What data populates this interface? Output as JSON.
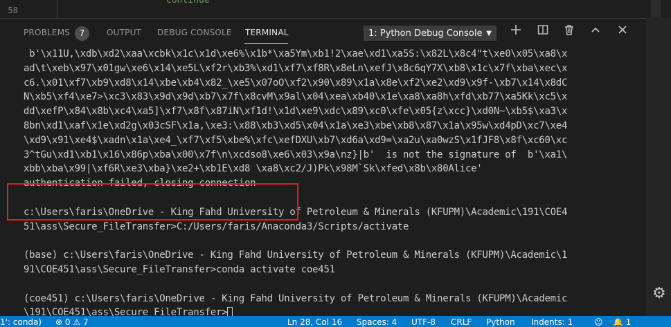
{
  "editor": {
    "line_number": "58",
    "code_fragment": "continue"
  },
  "panel": {
    "tabs": {
      "problems": "PROBLEMS",
      "problems_count": "7",
      "output": "OUTPUT",
      "debug_console": "DEBUG CONSOLE",
      "terminal": "TERMINAL"
    },
    "terminal_selector": "1: Python Debug Console",
    "icons": [
      "plus-icon",
      "split-icon",
      "trash-icon",
      "chevron-up-icon",
      "close-icon"
    ]
  },
  "terminal": {
    "lines": [
      " b'\\x11U,\\xdb\\xd2\\xaa\\xcbk\\x1c\\x1d\\xe6%\\x1b*\\xa5Ym\\xb1!2\\xae\\xd1\\xa5S:\\x82L\\x8c4\"t\\xe0\\x05\\xa8\\x",
      "ad\\t\\xeb\\x97\\x01gw\\xe6\\x14\\xe5L\\xf2r\\xb3%\\xd1\\xf7\\xf8R\\x8eLn\\xefJ\\x8c6qY7X\\xb8\\x1c\\x7f\\xba\\xec\\x",
      "c6.\\x01\\xf7\\xb9\\xd8\\x14\\xbe\\xb4\\x82_\\xe5\\x07oO\\xf2\\x90\\x89\\x1a\\x8e\\xf2\\xe2\\xd9\\x9f-\\xb7\\x14\\x8dC",
      "N\\xb5\\xf4\\xe7>\\xc3\\x83\\x9d\\x9d\\xb7\\x7f\\x8cvM\\x9al\\x04\\xea\\xb40\\x1e\\xa8\\xa8h\\xfd\\xb77\\xa5Kk\\xc5\\x",
      "dd\\xefP\\x84\\x8b\\xc4\\xa5]\\xf7\\x8f\\x87iN\\xf1d!\\x1d\\xe9\\xdc\\x89\\xc0\\xfe\\x05{z\\xcc}\\xd0N~\\xb5$\\xa3\\x",
      "8bn\\xd1\\xaf\\x1e\\xd2g\\x03cSF\\x1a,\\xe3:\\x88\\xb3\\xd5\\x04\\x1a\\xe3\\xbe\\xb8\\x87\\x1a\\x95w\\xd4pD\\xc7\\xe4",
      "\\xd9\\x91\\xe4$\\xadn\\x1a\\xe4_\\xf7\\xf5\\xbe%\\xfc\\xefDXU\\xb7\\xd6a\\xd9=\\xa2u\\xa0wzS\\x1fJF8\\x8f\\xc60\\xc",
      "3^tGu\\xd1\\xb1\\x16\\x86p\\xba\\x00\\x7f\\n\\xcdso8\\xe6\\x03\\x9a\\nz}|b'  is not the signature of  b'\\xa1\\",
      "xbb\\xba\\x99|\\xf6R\\xe3\\xba}\\xe2+\\xb1E\\xd8 \\xa8\\xc2/J)Pk\\x98M`Sk\\xfed\\x8b\\x80Alice'",
      "authentication failed, closing connection",
      "",
      "c:\\Users\\faris\\OneDrive - King Fahd University of Petroleum & Minerals (KFUPM)\\Academic\\191\\COE4",
      "51\\ass\\Secure_FileTransfer>C:/Users/faris/Anaconda3/Scripts/activate",
      "",
      "(base) c:\\Users\\faris\\OneDrive - King Fahd University of Petroleum & Minerals (KFUPM)\\Academic\\1",
      "91\\COE451\\ass\\Secure_FileTransfer>conda activate coe451",
      "",
      "(coe451) c:\\Users\\faris\\OneDrive - King Fahd University of Petroleum & Minerals (KFUPM)\\Academic",
      "\\191\\COE451\\ass\\Secure_FileTransfer>"
    ]
  },
  "statusbar": {
    "interpreter": "1': conda)",
    "errors": "0",
    "warnings": "7",
    "position": "Ln 28, Col 16",
    "spaces": "Spaces: 4",
    "encoding": "UTF-8",
    "eol": "CRLF",
    "language": "Python",
    "indents": "Indents: 1",
    "notifications": "1"
  },
  "colors": {
    "status_bar": "#007acc",
    "highlight_box": "#e01e1e",
    "panel_bg": "#1e1e1e"
  }
}
